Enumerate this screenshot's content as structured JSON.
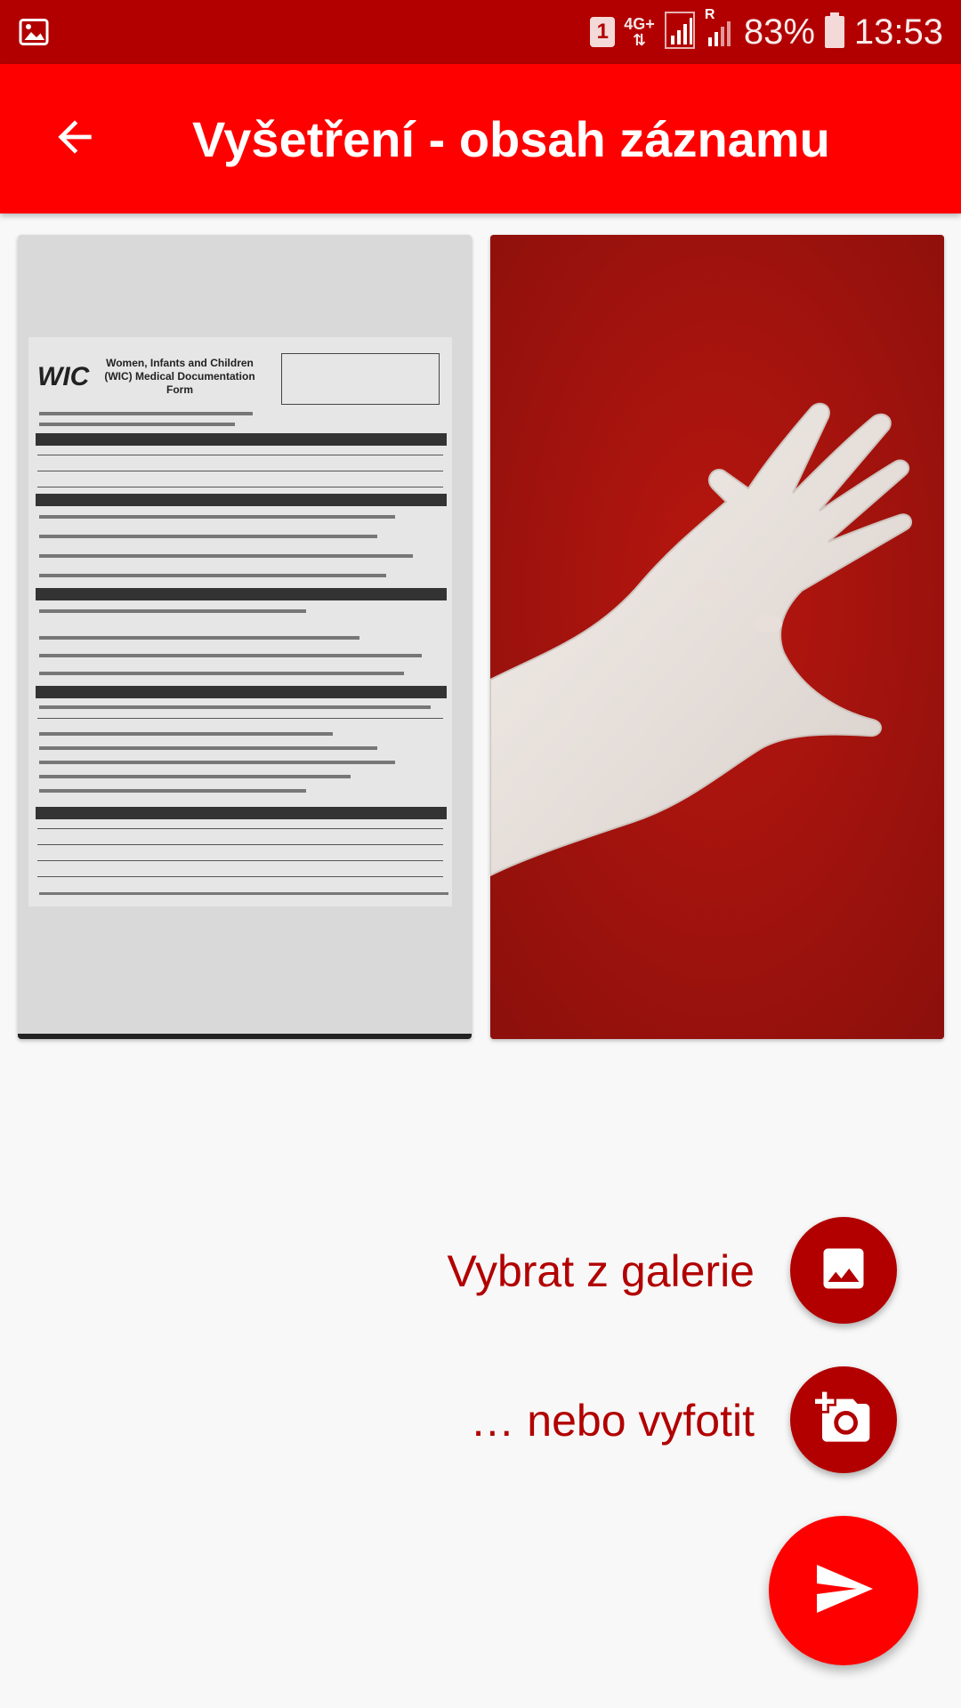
{
  "status_bar": {
    "sim_slot": "1",
    "network_type": "4G+",
    "roaming": "R",
    "battery_percent": "83%",
    "time": "13:53"
  },
  "app_bar": {
    "title": "Vyšetření - obsah záznamu"
  },
  "form_document": {
    "logo_text": "WIC",
    "title": "Women, Infants and Children (WIC) Medical Documentation Form"
  },
  "actions": {
    "gallery_label": "Vybrat z galerie",
    "camera_label": "… nebo vyfotit"
  },
  "colors": {
    "status_bar": "#b20000",
    "app_bar": "#ff0000",
    "mini_fab": "#b20000",
    "send_fab": "#ff0000",
    "label_text": "#b20000"
  },
  "icons": {
    "back": "arrow-left-icon",
    "gallery": "image-icon",
    "camera": "add-a-photo-icon",
    "send": "send-icon"
  }
}
